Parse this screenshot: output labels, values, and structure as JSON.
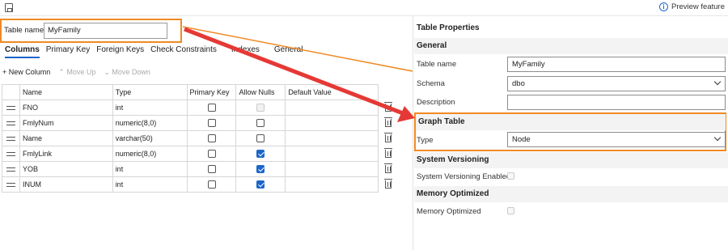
{
  "toolbar": {
    "preview_label": "Preview feature"
  },
  "table_name": {
    "label": "Table name",
    "value": "MyFamily"
  },
  "tabs": [
    {
      "label": "Columns",
      "active": true
    },
    {
      "label": "Primary Key"
    },
    {
      "label": "Foreign Keys"
    },
    {
      "label": "Check Constraints"
    },
    {
      "label": "Indexes"
    },
    {
      "label": "General"
    }
  ],
  "column_tools": {
    "new_column": "+ New Column",
    "move_up": "Move Up",
    "move_down": "Move Down"
  },
  "grid": {
    "headers": [
      "Name",
      "Type",
      "Primary Key",
      "Allow Nulls",
      "Default Value"
    ],
    "rows": [
      {
        "name": "FNO",
        "type": "int",
        "primary_key": false,
        "allow_nulls": false,
        "allow_nulls_disabled": true
      },
      {
        "name": "FmlyNum",
        "type": "numeric(8,0)",
        "primary_key": false,
        "allow_nulls": false
      },
      {
        "name": "Name",
        "type": "varchar(50)",
        "primary_key": false,
        "allow_nulls": false
      },
      {
        "name": "FmlyLink",
        "type": "numeric(8,0)",
        "primary_key": false,
        "allow_nulls": true
      },
      {
        "name": "YOB",
        "type": "int",
        "primary_key": false,
        "allow_nulls": true
      },
      {
        "name": "INUM",
        "type": "int",
        "primary_key": false,
        "allow_nulls": true
      }
    ]
  },
  "properties": {
    "title": "Table Properties",
    "general": {
      "heading": "General",
      "table_name_label": "Table name",
      "table_name_value": "MyFamily",
      "schema_label": "Schema",
      "schema_value": "dbo",
      "description_label": "Description",
      "description_value": ""
    },
    "graph_table": {
      "heading": "Graph Table",
      "type_label": "Type",
      "type_value": "Node"
    },
    "system_versioning": {
      "heading": "System Versioning",
      "enabled_label": "System Versioning Enabled"
    },
    "memory_optimized": {
      "heading": "Memory Optimized",
      "label": "Memory Optimized"
    }
  },
  "colors": {
    "accent": "#1a66c9",
    "highlight": "#f08a24",
    "arrow": "#e53935"
  }
}
